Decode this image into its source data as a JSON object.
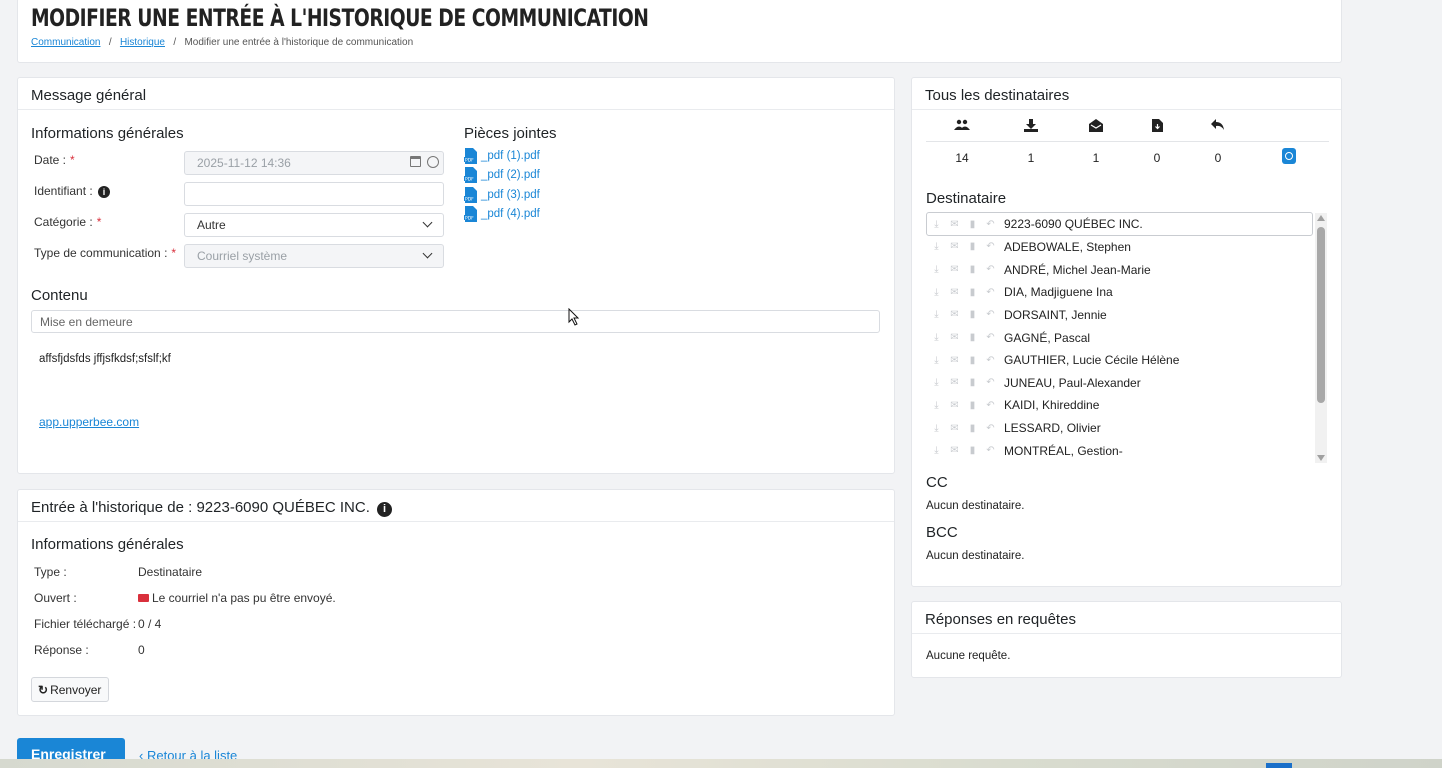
{
  "page": {
    "title": "MODIFIER UNE ENTRÉE À L'HISTORIQUE DE COMMUNICATION",
    "breadcrumb": [
      "Communication",
      "Historique",
      "Modifier une entrée à l'historique de communication"
    ]
  },
  "message": {
    "card_title": "Message général",
    "info_title": "Informations générales",
    "date_label": "Date :",
    "date_value": "2025-11-12 14:36",
    "id_label": "Identifiant :",
    "category_label": "Catégorie :",
    "category_value": "Autre",
    "type_label": "Type de communication :",
    "type_value": "Courriel système",
    "attachments_title": "Pièces jointes",
    "attachments": [
      "_pdf (1).pdf",
      "_pdf (2).pdf",
      "_pdf (3).pdf",
      "_pdf (4).pdf"
    ],
    "content_title": "Contenu",
    "subject": "Mise en demeure",
    "body": "affsfjdsfds jffjsfkdsf;sfslf;kf",
    "link": "app.upperbee.com"
  },
  "history": {
    "card_title": "Entrée à l'historique de : 9223-6090 QUÉBEC INC.",
    "info_title": "Informations générales",
    "rows": [
      {
        "label": "Type :",
        "value": "Destinataire"
      },
      {
        "label": "Ouvert :",
        "value": "Le courriel n'a pas pu être envoyé."
      },
      {
        "label": "Fichier téléchargé :",
        "value": "0 / 4"
      },
      {
        "label": "Réponse :",
        "value": "0"
      }
    ],
    "resend_label": "Renvoyer"
  },
  "recipients": {
    "card_title": "Tous les destinataires",
    "stats": [
      {
        "icon": "users-icon",
        "value": "14"
      },
      {
        "icon": "download-icon",
        "value": "1"
      },
      {
        "icon": "envelope-open-icon",
        "value": "1"
      },
      {
        "icon": "file-download-icon",
        "value": "0"
      },
      {
        "icon": "reply-icon",
        "value": "0"
      }
    ],
    "list_title": "Destinataire",
    "list": [
      "9223-6090 QUÉBEC INC.",
      "ADEBOWALE, Stephen",
      "ANDRÉ, Michel Jean-Marie",
      "DIA, Madjiguene Ina",
      "DORSAINT, Jennie",
      "GAGNÉ, Pascal",
      "GAUTHIER, Lucie Cécile Hélène",
      "JUNEAU, Paul-Alexander",
      "KAIDI, Khireddine",
      "LESSARD, Olivier",
      "MONTRÉAL, Gestion-"
    ],
    "cc_title": "CC",
    "cc_value": "Aucun destinataire.",
    "bcc_title": "BCC",
    "bcc_value": "Aucun destinataire."
  },
  "requests": {
    "card_title": "Réponses en requêtes",
    "value": "Aucune requête."
  },
  "footer": {
    "save_label": "Enregistrer",
    "back_label": "Retour à la liste"
  },
  "colors": {
    "accent": "#1a86d6",
    "required": "#d9303c",
    "error_envelope": "#d9303c"
  }
}
